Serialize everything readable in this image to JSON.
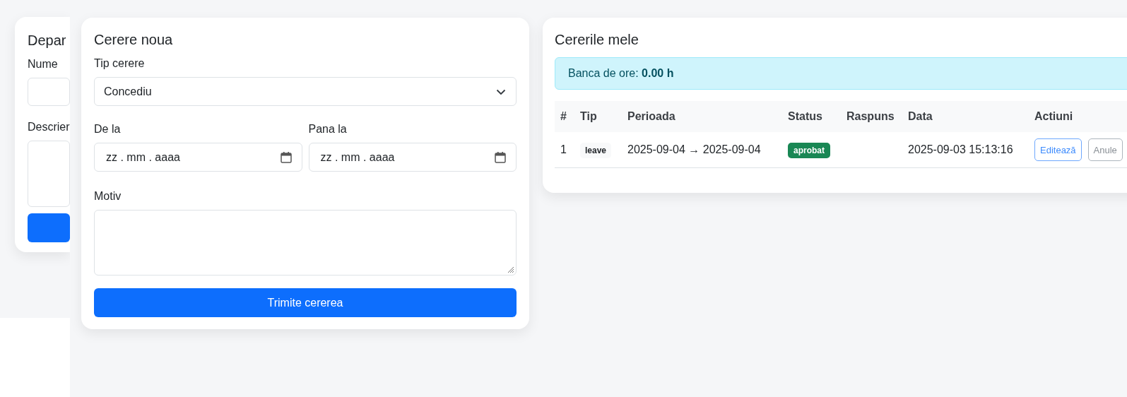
{
  "department_card": {
    "title": "Depar",
    "fields": [
      {
        "label": "Nume",
        "kind": "input"
      },
      {
        "label": "Descrier",
        "kind": "textarea"
      }
    ]
  },
  "new_request": {
    "title": "Cerere noua",
    "type_field": {
      "label": "Tip cerere",
      "value": "Concediu"
    },
    "dates": [
      {
        "label": "De la",
        "placeholder": "zz . mm . aaaa"
      },
      {
        "label": "Pana la",
        "placeholder": "zz . mm . aaaa"
      }
    ],
    "reason": {
      "label": "Motiv"
    },
    "submit": "Trimite cererea"
  },
  "my_requests": {
    "title": "Cererile mele",
    "balance": "Banca de ore: **0.00 h**",
    "columns": [
      "#",
      "Tip",
      "Perioada",
      "Status",
      "Raspuns",
      "Data",
      "Actiuni"
    ],
    "rows": [
      {
        "number": "1",
        "type": "leave",
        "period": "2025-09-04 → 2025-09-04",
        "status": "aprobat",
        "color": "#198754",
        "date": "2025-09-03 15:13:16",
        "actions": [
          {
            "label": "Editează",
            "kind": "primary"
          },
          {
            "label": "Anule",
            "kind": "secondary"
          }
        ]
      }
    ]
  }
}
